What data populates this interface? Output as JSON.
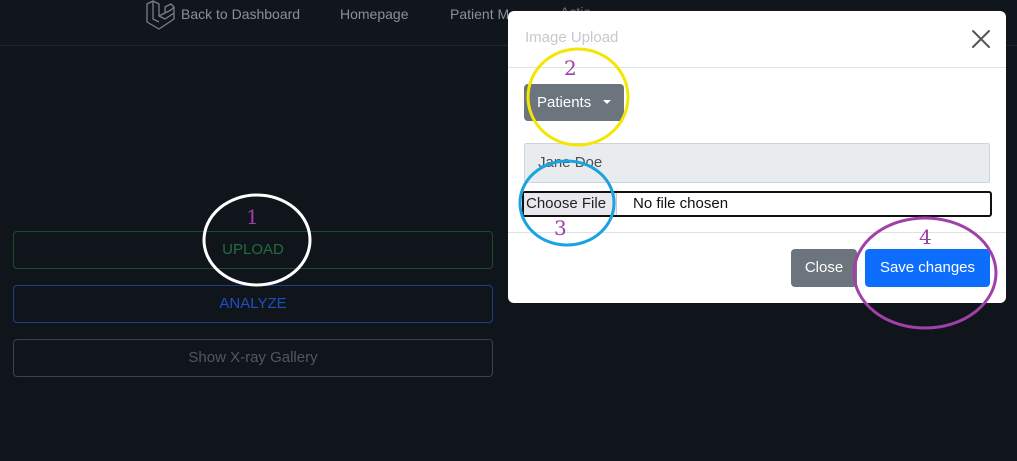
{
  "navbar": {
    "links": [
      "Back to Dashboard",
      "Homepage",
      "Patient M",
      "Actio"
    ]
  },
  "sidebar_buttons": {
    "upload": "UPLOAD",
    "analyze": "ANALYZE",
    "gallery": "Show X-ray Gallery"
  },
  "modal": {
    "title": "Image Upload",
    "dropdown_label": "Patients",
    "patient_value": "Jane Doe",
    "file_button_label": "Choose File",
    "file_status": "No file chosen",
    "close_label": "Close",
    "save_label": "Save changes"
  },
  "annotations": {
    "labels": [
      "1",
      "2",
      "3",
      "4"
    ],
    "colors": {
      "circle1": "#ffffff",
      "circle2": "#f5e600",
      "circle3": "#1aa3e0",
      "circle4": "#a040a8",
      "number": "#9b3fa8"
    }
  },
  "colors": {
    "background": "#10151c",
    "primary": "#0d6efd",
    "secondary": "#6c757d"
  }
}
